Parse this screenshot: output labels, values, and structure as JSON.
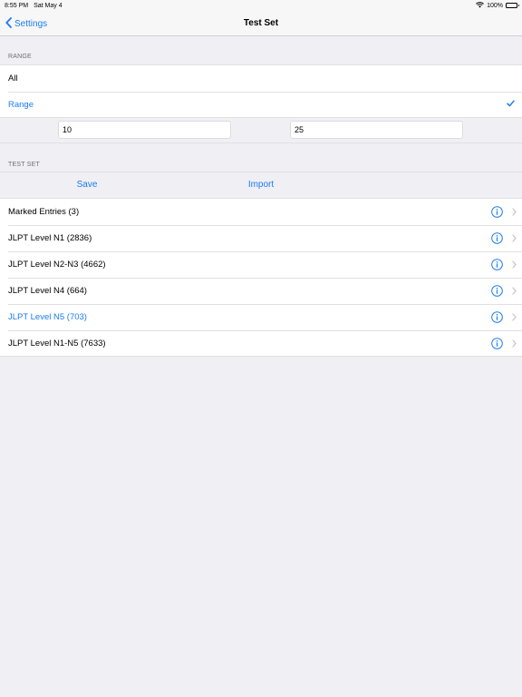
{
  "status": {
    "time": "8:55 PM",
    "date": "Sat May 4",
    "battery": "100%"
  },
  "nav": {
    "back_label": "Settings",
    "title": "Test Set"
  },
  "range_section": {
    "header": "RANGE",
    "options": [
      {
        "label": "All",
        "selected": false
      },
      {
        "label": "Range",
        "selected": true
      }
    ],
    "from_value": "10",
    "to_value": "25"
  },
  "test_set_section": {
    "header": "TEST SET",
    "save_label": "Save",
    "import_label": "Import",
    "items": [
      {
        "label": "Marked Entries (3)",
        "selected": false
      },
      {
        "label": "JLPT Level N1 (2836)",
        "selected": false
      },
      {
        "label": "JLPT Level N2-N3 (4662)",
        "selected": false
      },
      {
        "label": "JLPT Level N4 (664)",
        "selected": false
      },
      {
        "label": "JLPT Level N5 (703)",
        "selected": true
      },
      {
        "label": "JLPT Level N1-N5 (7633)",
        "selected": false
      }
    ]
  },
  "colors": {
    "accent": "#1b7cf3",
    "background": "#efeff4",
    "header_text": "#6d6d72"
  }
}
